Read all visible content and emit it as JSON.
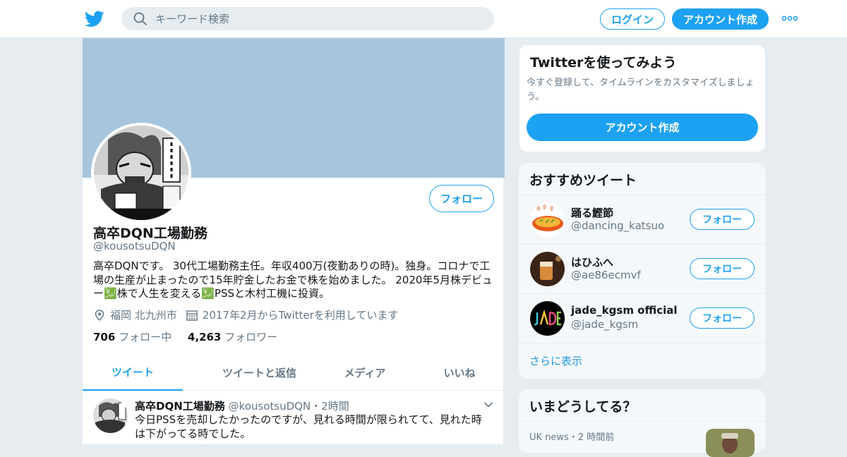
{
  "header": {
    "search_placeholder": "キーワード検索",
    "login_label": "ログイン",
    "signup_label": "アカウント作成",
    "brand_color": "#1da1f2"
  },
  "profile": {
    "name": "高卒DQN工場勤務",
    "handle": "@kousotsuDQN",
    "follow_label": "フォロー",
    "bio": "高卒DQNです。 30代工場勤務主任。年収400万(夜勤ありの時)。独身。コロナで工場の生産が止まったので15年貯金したお金で株を始めました。 2020年5月株デビュー💹株で人生を変える💹PSSと木村工機に投資。",
    "location": "福岡 北九州市",
    "joined": "2017年2月からTwitterを利用しています",
    "following_count": "706",
    "following_label": "フォロー中",
    "followers_count": "4,263",
    "followers_label": "フォロワー"
  },
  "tabs": [
    {
      "label": "ツイート",
      "active": true
    },
    {
      "label": "ツイートと返信",
      "active": false
    },
    {
      "label": "メディア",
      "active": false
    },
    {
      "label": "いいね",
      "active": false
    }
  ],
  "tweet": {
    "name": "高卒DQN工場勤務",
    "handle": "@kousotsuDQN",
    "separator": "・",
    "time": "2時間",
    "text": "今日PSSを売却したかったのですが、見れる時間が限られてて、見れた時は下がってる時でした。"
  },
  "signup_card": {
    "title": "Twitterを使ってみよう",
    "description": "今すぐ登録して、タイムラインをカスタマイズしましょう。",
    "button_label": "アカウント作成"
  },
  "recommended": {
    "title": "おすすめツイート",
    "follow_label": "フォロー",
    "accounts": [
      {
        "name": "踊る鰹節",
        "handle": "@dancing_katsuo"
      },
      {
        "name": "はひふへ",
        "handle": "@ae86ecmvf"
      },
      {
        "name": "jade_kgsm official",
        "handle": "@jade_kgsm"
      }
    ],
    "more_label": "さらに表示"
  },
  "trends": {
    "title": "いまどうしてる？",
    "source": "UK news",
    "separator": "・",
    "time": "2 時間前"
  }
}
